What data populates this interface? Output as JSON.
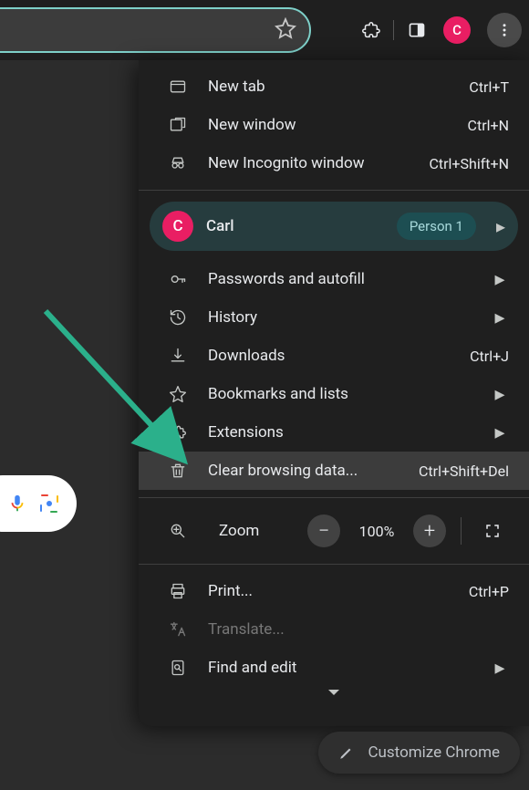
{
  "toolbar": {
    "avatar_letter": "C"
  },
  "menu": {
    "new_tab": {
      "label": "New tab",
      "shortcut": "Ctrl+T"
    },
    "new_window": {
      "label": "New window",
      "shortcut": "Ctrl+N"
    },
    "new_incognito": {
      "label": "New Incognito window",
      "shortcut": "Ctrl+Shift+N"
    },
    "profile": {
      "name": "Carl",
      "person": "Person 1",
      "avatar_letter": "C"
    },
    "passwords": {
      "label": "Passwords and autofill"
    },
    "history": {
      "label": "History"
    },
    "downloads": {
      "label": "Downloads",
      "shortcut": "Ctrl+J"
    },
    "bookmarks": {
      "label": "Bookmarks and lists"
    },
    "extensions": {
      "label": "Extensions"
    },
    "clear": {
      "label": "Clear browsing data...",
      "shortcut": "Ctrl+Shift+Del"
    },
    "zoom": {
      "label": "Zoom",
      "pct": "100%"
    },
    "print": {
      "label": "Print...",
      "shortcut": "Ctrl+P"
    },
    "translate": {
      "label": "Translate..."
    },
    "find": {
      "label": "Find and edit"
    }
  },
  "customize": {
    "label": "Customize Chrome"
  }
}
